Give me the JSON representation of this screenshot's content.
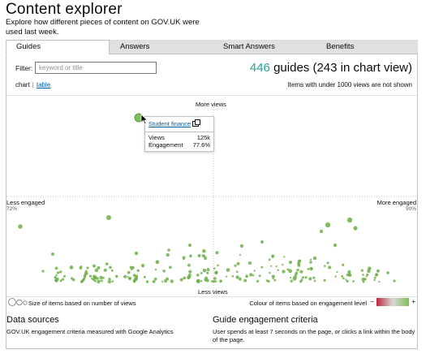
{
  "header": {
    "title": "Content explorer",
    "description": "Explore how different pieces of content on GOV.UK were used last week."
  },
  "tabs": [
    {
      "label": "Guides",
      "active": true
    },
    {
      "label": "Answers",
      "active": false
    },
    {
      "label": "Smart Answers",
      "active": false
    },
    {
      "label": "Benefits",
      "active": false
    }
  ],
  "filter": {
    "label": "Filter:",
    "placeholder": "keyword or title",
    "value": ""
  },
  "count": {
    "number": "446",
    "text": "guides (243 in chart view)"
  },
  "view_toggle": {
    "chart_label": "chart",
    "table_label": "table",
    "active": "chart"
  },
  "threshold_note": "Items with under 1000 views are not shown",
  "chart_data": {
    "type": "scatter",
    "axes": {
      "top": "More views",
      "bottom": "Less views",
      "left": "Less engaged",
      "left_value": "72%",
      "right": "More engaged",
      "right_value": "90%"
    },
    "x_range_engagement": [
      72,
      90
    ],
    "colour_scale": {
      "low": "#c0283a",
      "mid": "#d7d7d7",
      "high": "#7fbf5a"
    },
    "highlighted": {
      "title": "Student finance",
      "views_label": "Views",
      "views": "125k",
      "engagement_label": "Engagement",
      "engagement": "77.6%"
    }
  },
  "legend": {
    "size_text": "Size of items based on number of views",
    "colour_text": "Colour of items based on engagement level",
    "minus": "−",
    "plus": "+"
  },
  "info": {
    "data_sources_title": "Data sources",
    "data_sources_text": "GOV.UK engagement criteria measured with Google Analytics",
    "criteria_title": "Guide engagement criteria",
    "criteria_text": "User spends at least 7 seconds on the page, or clicks a link within the body of the page."
  }
}
